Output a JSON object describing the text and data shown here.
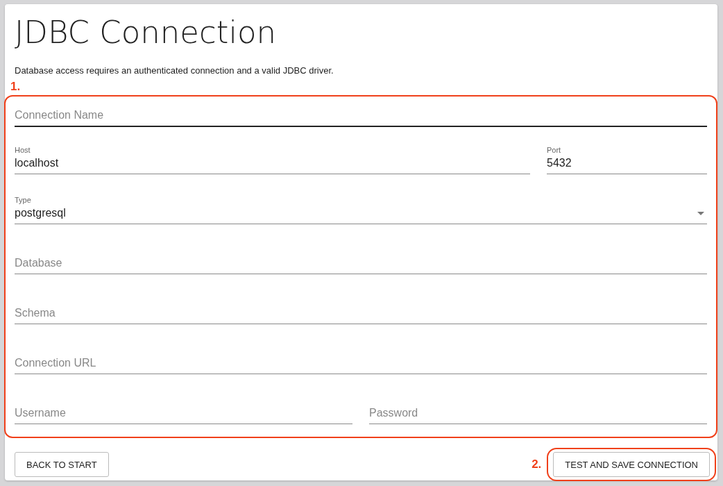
{
  "title": "JDBC Connection",
  "description": "Database access requires an authenticated connection and a valid JDBC driver.",
  "form_annotation": "1.",
  "rows": [
    {
      "fields": [
        {
          "kind": "text",
          "placeholder": "Connection Name",
          "focused": true
        }
      ]
    },
    {
      "fields": [
        {
          "kind": "text",
          "label": "Host",
          "value": "localhost",
          "focused": false
        },
        {
          "kind": "text",
          "label": "Port",
          "value": "5432",
          "focused": false
        }
      ]
    },
    {
      "fields": [
        {
          "kind": "select",
          "label": "Type",
          "value": "postgresql",
          "focused": false
        }
      ]
    },
    {
      "fields": [
        {
          "kind": "text",
          "placeholder": "Database",
          "focused": false
        }
      ]
    },
    {
      "fields": [
        {
          "kind": "text",
          "placeholder": "Schema",
          "focused": false
        }
      ]
    },
    {
      "fields": [
        {
          "kind": "text",
          "placeholder": "Connection URL",
          "focused": false
        }
      ]
    },
    {
      "fields": [
        {
          "kind": "text",
          "placeholder": "Username",
          "focused": false
        },
        {
          "kind": "password",
          "placeholder": "Password",
          "focused": false
        }
      ]
    }
  ],
  "back_button": "BACK TO START",
  "save_annotation": "2.",
  "save_button": "TEST AND SAVE CONNECTION"
}
